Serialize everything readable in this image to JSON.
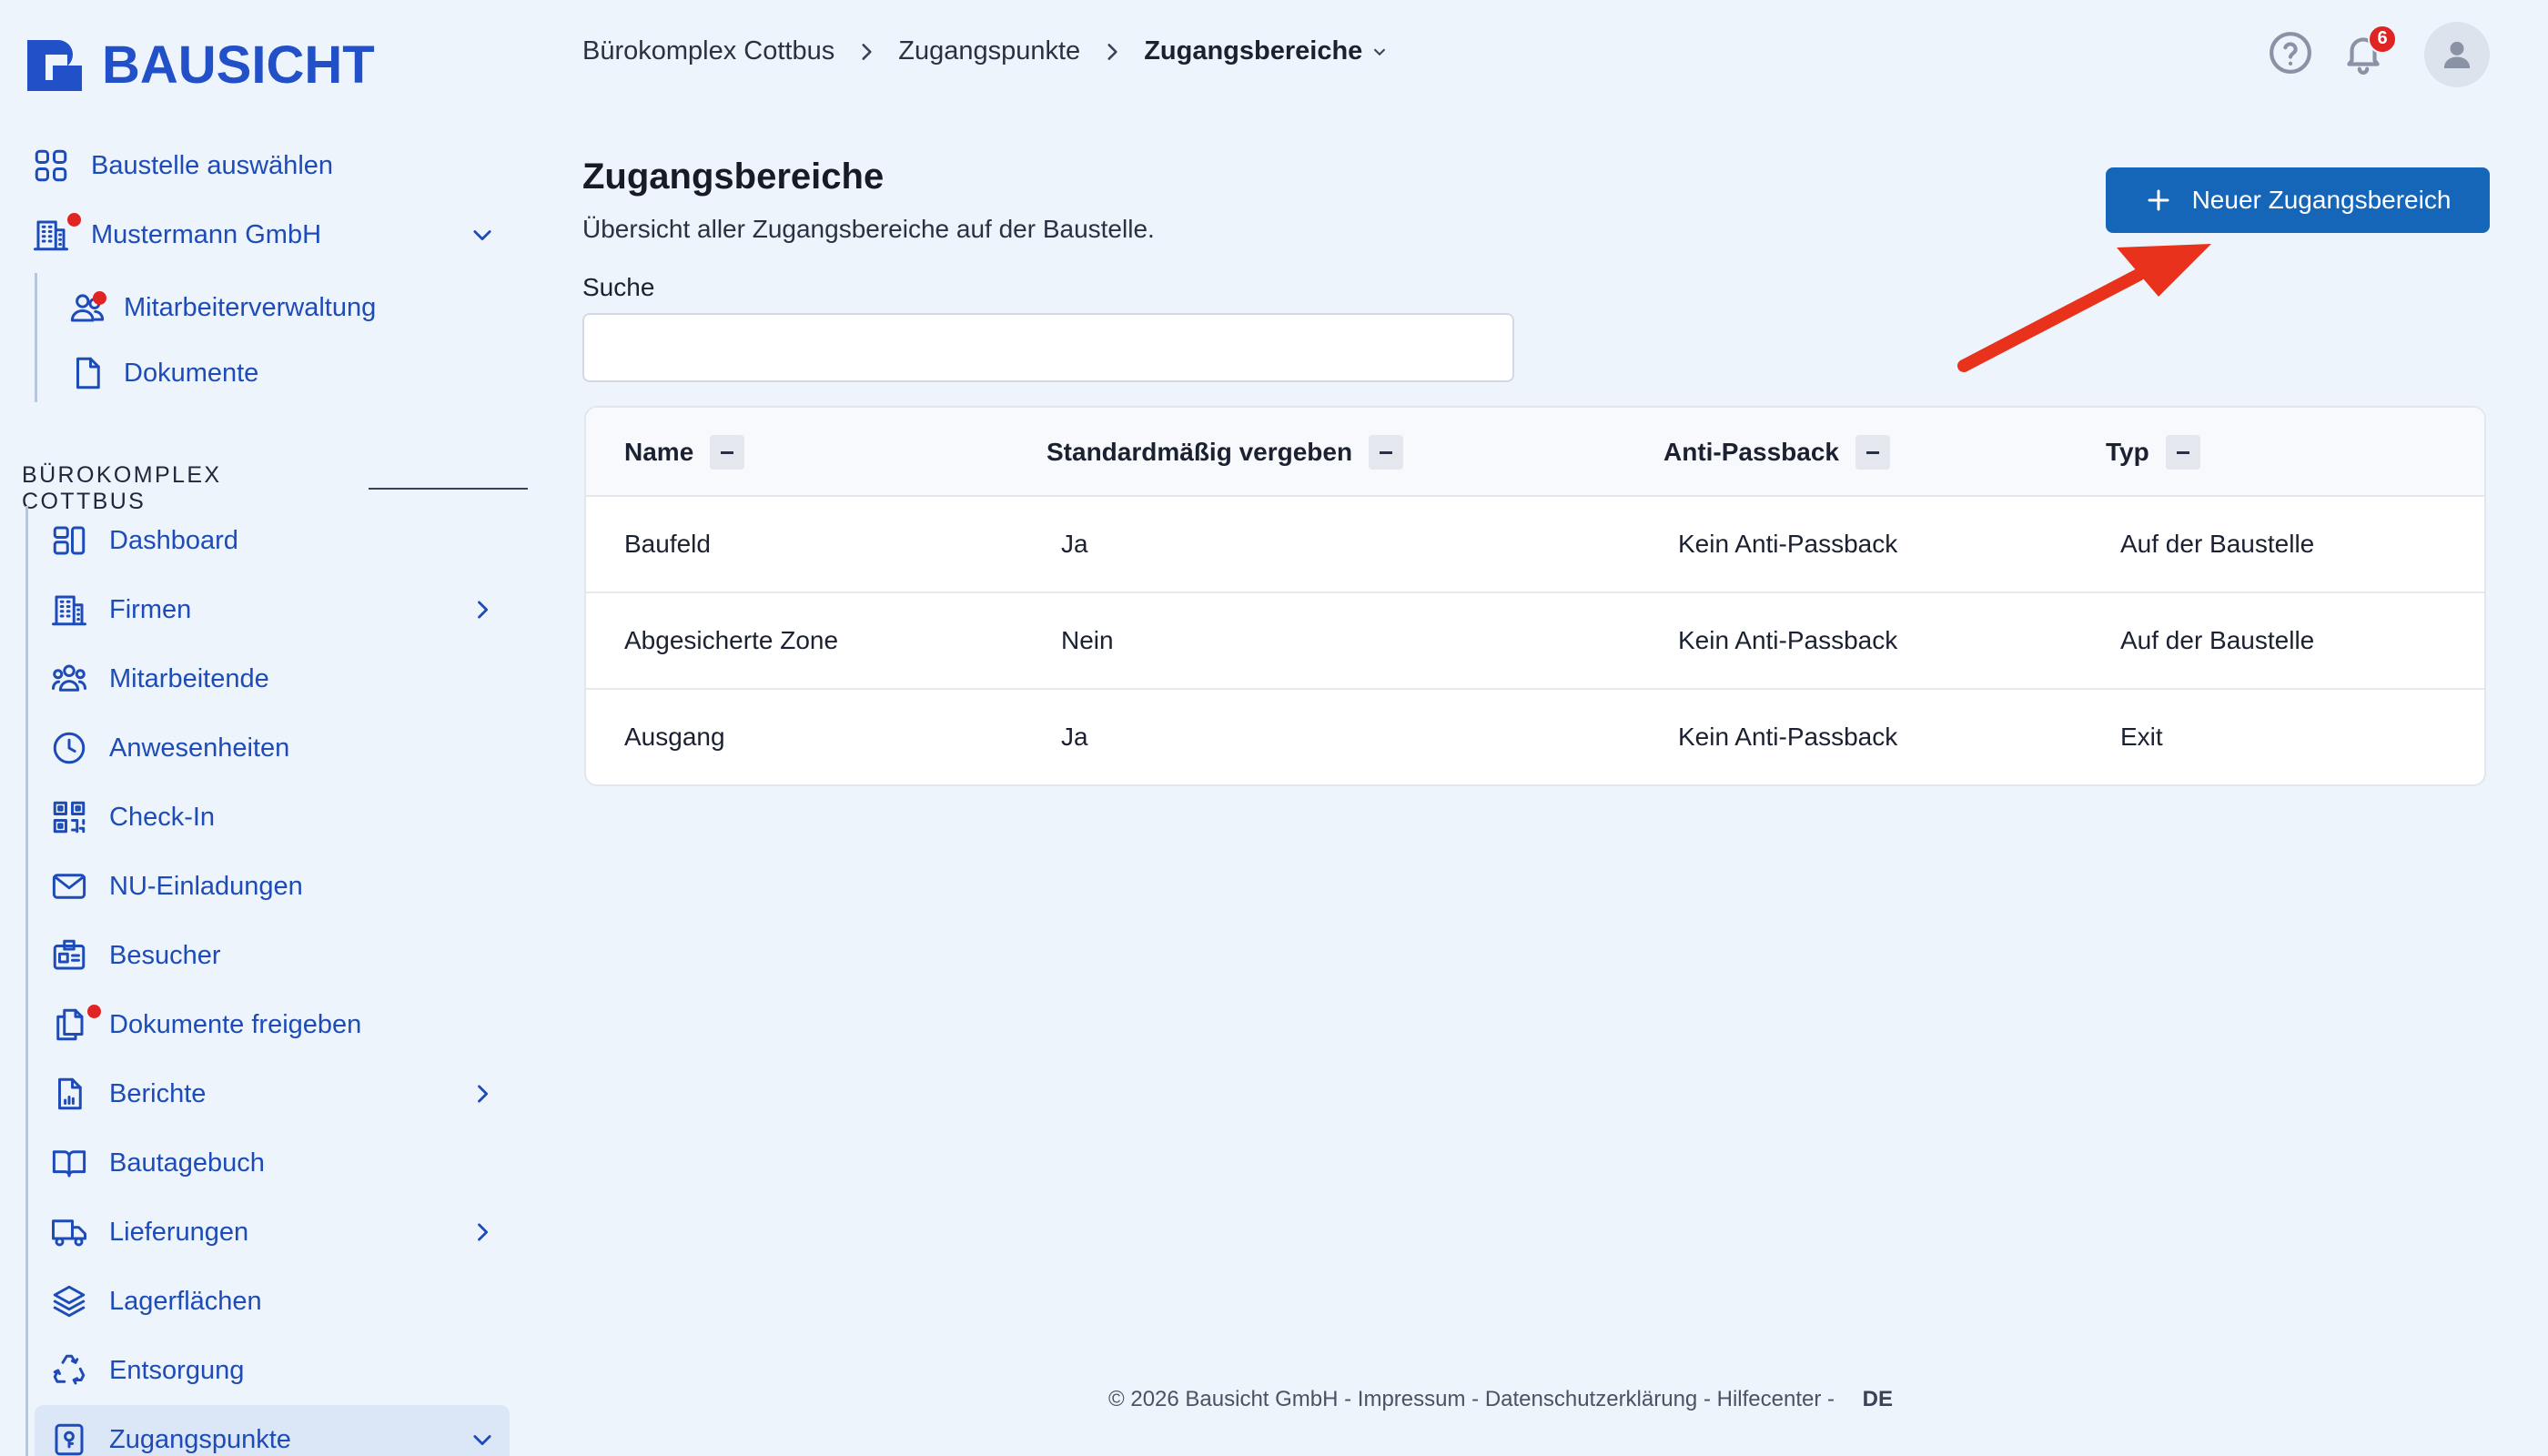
{
  "brand": {
    "name": "BAUSICHT"
  },
  "sidebar": {
    "top_items": [
      {
        "label": "Baustelle auswählen"
      },
      {
        "label": "Mustermann GmbH"
      },
      {
        "label": "Mitarbeiterverwaltung"
      },
      {
        "label": "Dokumente"
      }
    ],
    "section_title": "BÜROKOMPLEX COTTBUS",
    "items": [
      {
        "label": "Dashboard"
      },
      {
        "label": "Firmen"
      },
      {
        "label": "Mitarbeitende"
      },
      {
        "label": "Anwesenheiten"
      },
      {
        "label": "Check-In"
      },
      {
        "label": "NU-Einladungen"
      },
      {
        "label": "Besucher"
      },
      {
        "label": "Dokumente freigeben"
      },
      {
        "label": "Berichte"
      },
      {
        "label": "Bautagebuch"
      },
      {
        "label": "Lieferungen"
      },
      {
        "label": "Lagerflächen"
      },
      {
        "label": "Entsorgung"
      },
      {
        "label": "Zugangspunkte"
      }
    ]
  },
  "breadcrumb": [
    "Bürokomplex Cottbus",
    "Zugangspunkte",
    "Zugangsbereiche"
  ],
  "header": {
    "notification_count": "6"
  },
  "main": {
    "title": "Zugangsbereiche",
    "subtitle": "Übersicht aller Zugangsbereiche auf der Baustelle.",
    "new_button": "Neuer Zugangsbereich",
    "search_label": "Suche",
    "search_value": ""
  },
  "table": {
    "columns": [
      "Name",
      "Standardmäßig vergeben",
      "Anti-Passback",
      "Typ"
    ],
    "rows": [
      [
        "Baufeld",
        "Ja",
        "Kein Anti-Passback",
        "Auf der Baustelle"
      ],
      [
        "Abgesicherte Zone",
        "Nein",
        "Kein Anti-Passback",
        "Auf der Baustelle"
      ],
      [
        "Ausgang",
        "Ja",
        "Kein Anti-Passback",
        "Exit"
      ]
    ]
  },
  "footer": {
    "copyright": "© 2026 Bausicht GmbH",
    "sep": " - ",
    "links": [
      "Impressum",
      "Datenschutzerklärung",
      "Hilfecenter"
    ],
    "language": "DE"
  },
  "colors": {
    "primary": "#1565b8",
    "nav_text": "#1d4bb8",
    "notification": "#e02424",
    "annotation_arrow": "#e8321c"
  }
}
